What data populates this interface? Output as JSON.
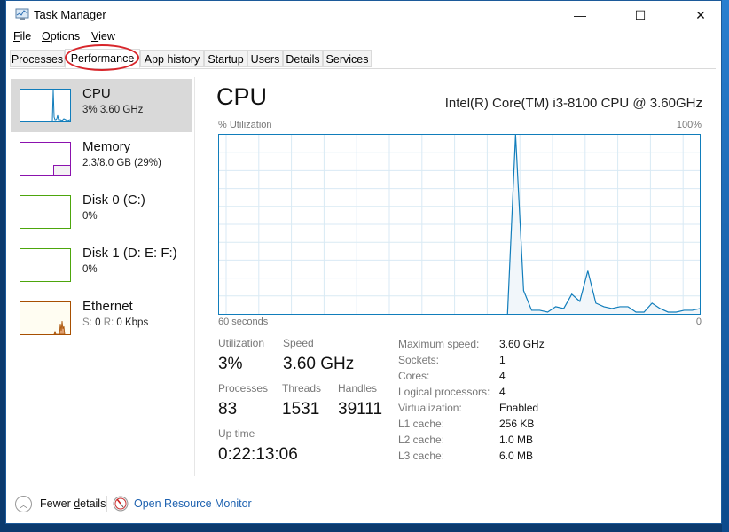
{
  "window": {
    "title": "Task Manager",
    "icon": "task-manager-icon",
    "controls": {
      "minimize": "—",
      "maximize": "☐",
      "close": "✕"
    }
  },
  "menu": [
    {
      "label": "File",
      "accel": "F",
      "rest": "ile"
    },
    {
      "label": "Options",
      "accel": "O",
      "rest": "ptions"
    },
    {
      "label": "View",
      "accel": "V",
      "rest": "iew"
    }
  ],
  "tabs": [
    {
      "label": "Processes"
    },
    {
      "label": "Performance",
      "active": true
    },
    {
      "label": "App history"
    },
    {
      "label": "Startup"
    },
    {
      "label": "Users"
    },
    {
      "label": "Details"
    },
    {
      "label": "Services"
    }
  ],
  "annotation": {
    "highlighted_tab": "Performance",
    "ring_color": "#d8262b"
  },
  "sidebar": {
    "items": [
      {
        "name": "CPU",
        "sub": "3%  3.60 GHz",
        "color": "#117dbb",
        "selected": true
      },
      {
        "name": "Memory",
        "sub": "2.3/8.0 GB (29%)",
        "color": "#8b12ae",
        "fill_fraction": 0.29
      },
      {
        "name": "Disk 0 (C:)",
        "sub": "0%",
        "color": "#4da60c"
      },
      {
        "name": "Disk 1 (D: E: F:)",
        "sub": "0%",
        "color": "#4da60c"
      },
      {
        "name": "Ethernet",
        "sub_s_label": "S:",
        "sub_s_val": "0",
        "sub_r_label": "R:",
        "sub_r_val": "0 Kbps",
        "color": "#a74f01"
      }
    ]
  },
  "main": {
    "title": "CPU",
    "model": "Intel(R) Core(TM) i3-8100 CPU @ 3.60GHz",
    "graph": {
      "y_label": "% Utilization",
      "y_max_label": "100%",
      "x_left_label": "60 seconds",
      "x_right_label": "0",
      "line_color": "#117dbb",
      "fill_color": "#f1f6fa",
      "grid_color": "#d9eaf4"
    },
    "stats": {
      "utilization": {
        "label": "Utilization",
        "value": "3%"
      },
      "speed": {
        "label": "Speed",
        "value": "3.60 GHz"
      },
      "processes": {
        "label": "Processes",
        "value": "83"
      },
      "threads": {
        "label": "Threads",
        "value": "1531"
      },
      "handles": {
        "label": "Handles",
        "value": "39111"
      },
      "uptime": {
        "label": "Up time",
        "value": "0:22:13:06"
      }
    },
    "details": [
      {
        "key": "Maximum speed:",
        "value": "3.60 GHz"
      },
      {
        "key": "Sockets:",
        "value": "1"
      },
      {
        "key": "Cores:",
        "value": "4"
      },
      {
        "key": "Logical processors:",
        "value": "4"
      },
      {
        "key": "Virtualization:",
        "value": "Enabled"
      },
      {
        "key": "L1 cache:",
        "value": "256 KB"
      },
      {
        "key": "L2 cache:",
        "value": "1.0 MB"
      },
      {
        "key": "L3 cache:",
        "value": "6.0 MB"
      }
    ]
  },
  "footer": {
    "fewer_details": "Fewer details",
    "fewer_accel_prefix": "Fewer ",
    "fewer_accel": "d",
    "fewer_accel_rest": "etails",
    "resource_monitor": "Open Resource Monitor"
  },
  "chart_data": {
    "type": "area",
    "title": "% Utilization",
    "xlabel": "seconds ago",
    "ylabel": "% Utilization",
    "x_range": [
      60,
      0
    ],
    "ylim": [
      0,
      100
    ],
    "grid": true,
    "x_seconds_ago": [
      24,
      23,
      22,
      21,
      20,
      19,
      18,
      17,
      16,
      15,
      14,
      13,
      12,
      11,
      10,
      9,
      8,
      7,
      6,
      5,
      4,
      3,
      2,
      1,
      0
    ],
    "values": [
      0,
      100,
      13,
      2,
      2,
      1,
      4,
      3,
      11,
      7,
      24,
      6,
      4,
      3,
      4,
      4,
      1,
      1,
      6,
      3,
      1,
      1,
      2,
      2,
      3
    ]
  }
}
